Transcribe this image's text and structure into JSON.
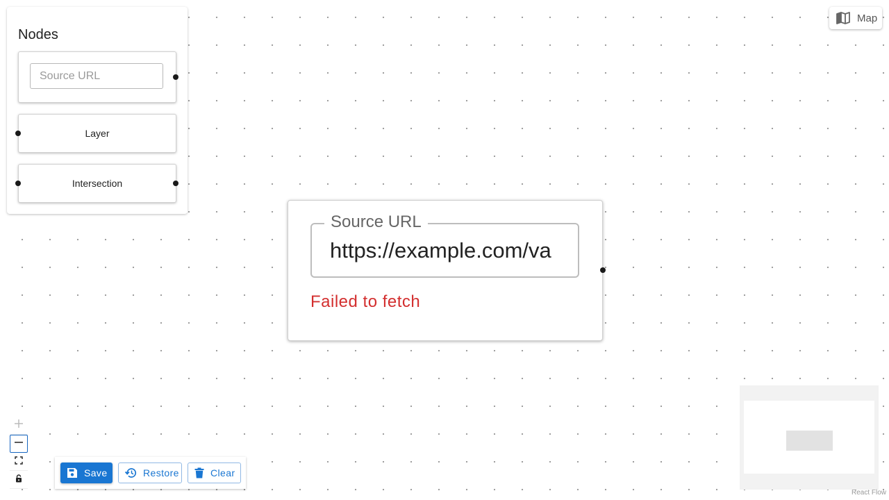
{
  "palette": {
    "title": "Nodes",
    "source_placeholder": "Source URL",
    "layer_label": "Layer",
    "intersection_label": "Intersection"
  },
  "main_node": {
    "field_label": "Source URL",
    "url_value": "https://example.com/va",
    "error": "Failed to fetch"
  },
  "map_button": {
    "label": "Map",
    "icon": "map-icon"
  },
  "controls": {
    "icons": [
      "zoom-in-icon",
      "zoom-out-icon",
      "fit-view-icon",
      "lock-icon"
    ]
  },
  "toolbar": {
    "save_label": "Save",
    "restore_label": "Restore",
    "clear_label": "Clear"
  },
  "attribution": "React Flow",
  "colors": {
    "primary": "#1976d2",
    "error": "#d32f2f",
    "handle": "#1a1a1a"
  }
}
